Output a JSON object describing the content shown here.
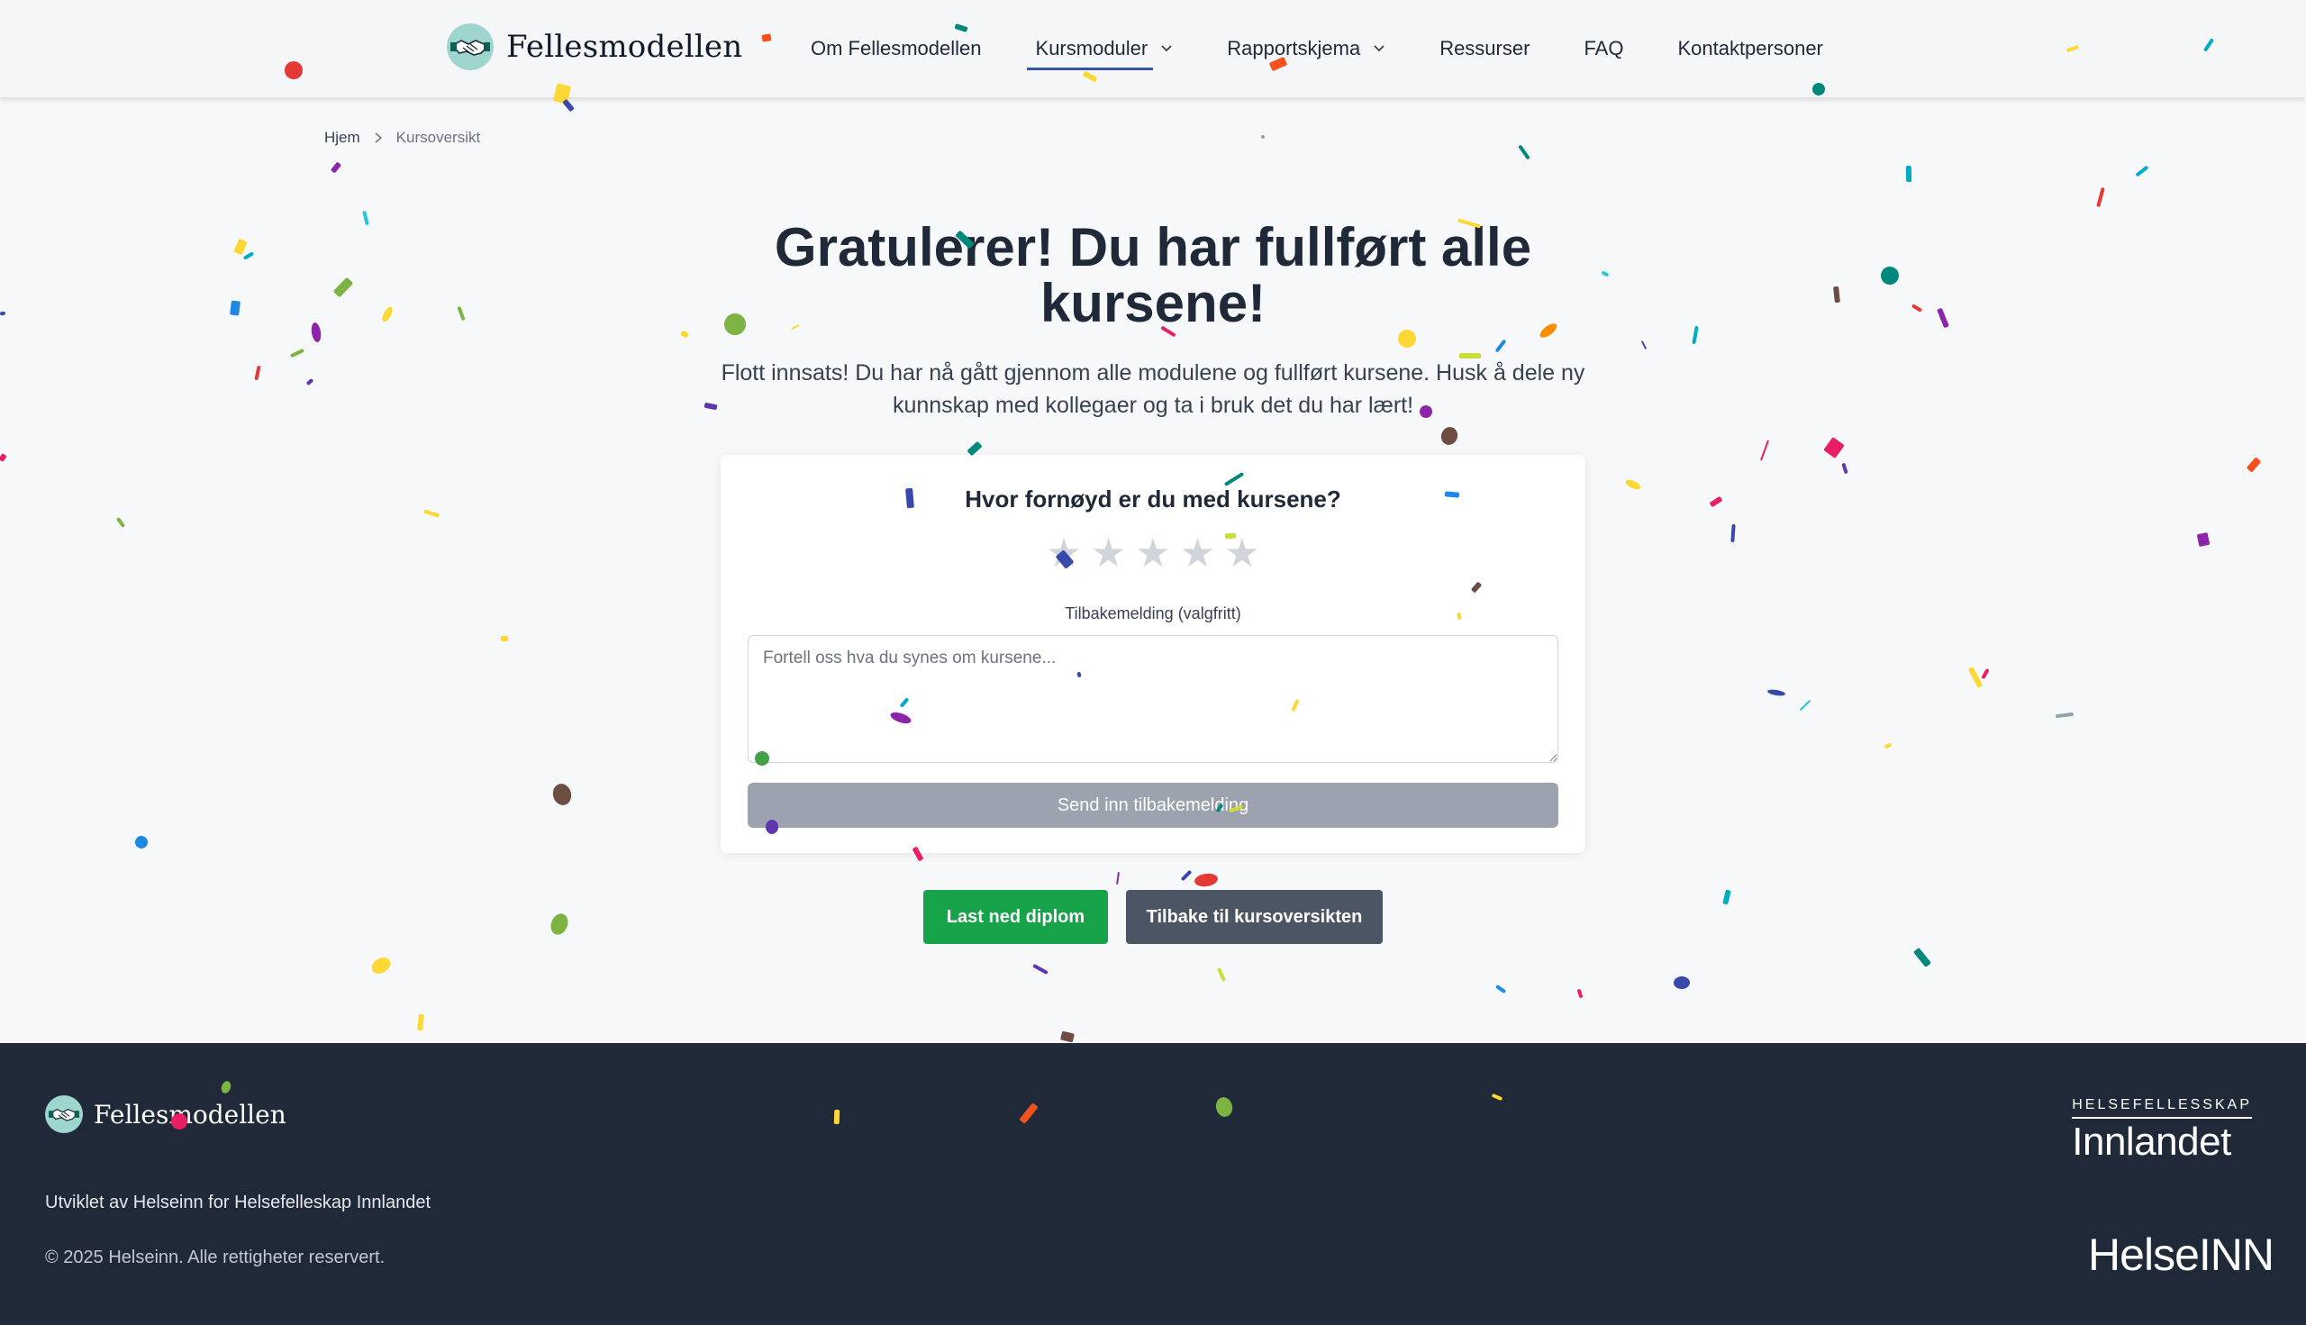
{
  "header": {
    "logo_text": "Fellesmodellen",
    "nav": [
      {
        "label": "Om Fellesmodellen",
        "dropdown": false,
        "active": false
      },
      {
        "label": "Kursmoduler",
        "dropdown": true,
        "active": true
      },
      {
        "label": "Rapportskjema",
        "dropdown": true,
        "active": false
      },
      {
        "label": "Ressurser",
        "dropdown": false,
        "active": false
      },
      {
        "label": "FAQ",
        "dropdown": false,
        "active": false
      },
      {
        "label": "Kontaktpersoner",
        "dropdown": false,
        "active": false
      }
    ]
  },
  "breadcrumb": {
    "home": "Hjem",
    "current": "Kursoversikt",
    "separator_icon": "chevron-right-icon"
  },
  "hero": {
    "title": "Gratulerer! Du har fullført alle kursene!",
    "subtitle": "Flott innsats! Du har nå gått gjennom alle modulene og fullført kursene. Husk å dele ny kunnskap med kollegaer og ta i bruk det du har lært!"
  },
  "feedback": {
    "question": "Hvor fornøyd er du med kursene?",
    "rating_max": 5,
    "rating_value": 0,
    "label": "Tilbakemelding (valgfritt)",
    "placeholder": "Fortell oss hva du synes om kursene...",
    "value": "",
    "submit_label": "Send inn tilbakemelding"
  },
  "actions": {
    "download_label": "Last ned diplom",
    "back_label": "Tilbake til kursoversikten"
  },
  "footer": {
    "logo_text": "Fellesmodellen",
    "developed_by": "Utviklet av Helseinn for Helsefelleskap Innlandet",
    "copyright": "© 2025 Helseinn. Alle rettigheter reservert.",
    "partner_top": "HELSEFELLESSKAP",
    "partner_name": "Innlandet",
    "partner2": "HelseINN"
  },
  "colors": {
    "primary_green": "#16a34a",
    "dark_button": "#4b5563",
    "disabled_button": "#9ca3af",
    "footer_bg": "#1f2937",
    "nav_active_underline": "#2f55a4",
    "star_inactive": "#d1d5db"
  }
}
